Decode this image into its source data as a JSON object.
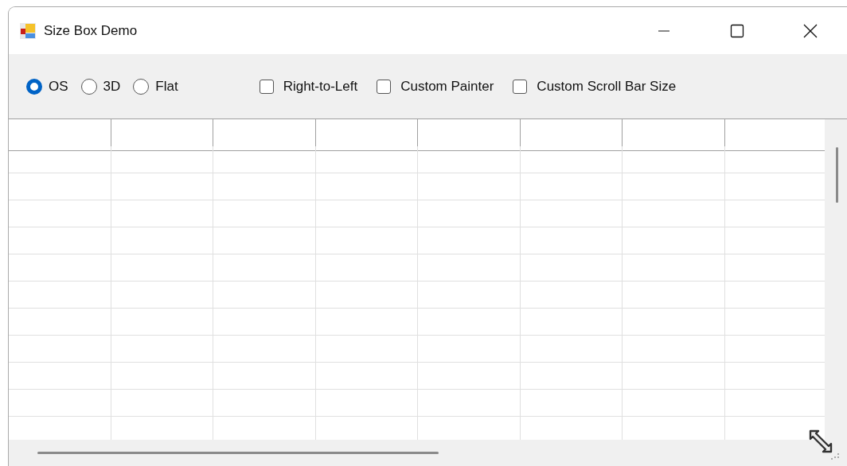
{
  "window": {
    "title": "Size Box Demo"
  },
  "border_styles": [
    {
      "label": "OS",
      "selected": true
    },
    {
      "label": "3D",
      "selected": false
    },
    {
      "label": "Flat",
      "selected": false
    }
  ],
  "options": [
    {
      "label": "Right-to-Left",
      "checked": false
    },
    {
      "label": "Custom Painter",
      "checked": false
    },
    {
      "label": "Custom Scroll Bar Size",
      "checked": false
    }
  ]
}
